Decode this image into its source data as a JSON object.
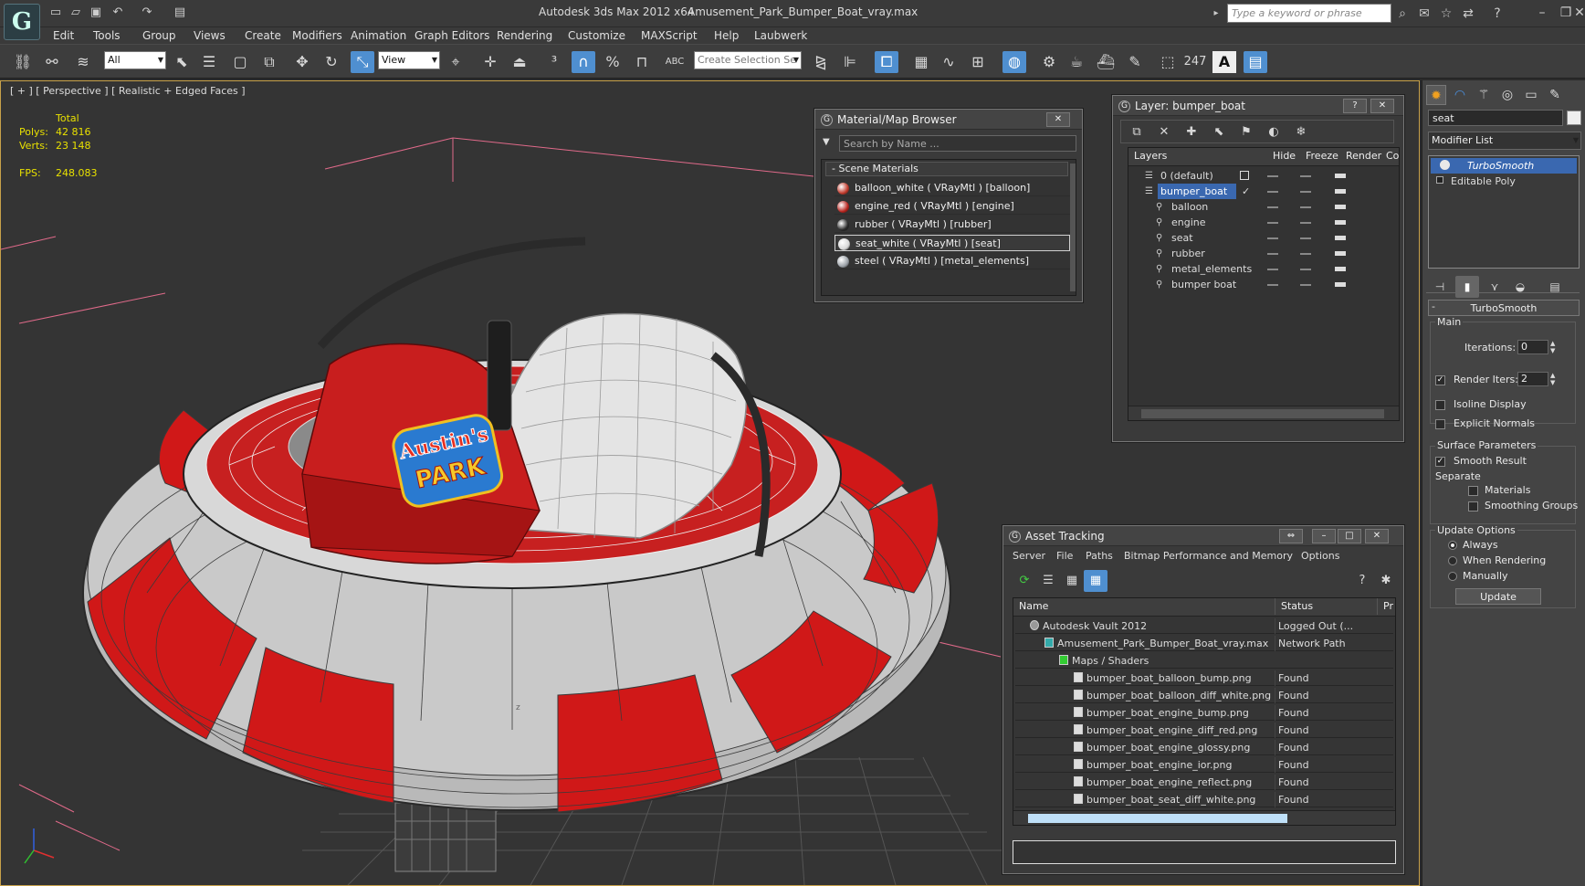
{
  "window": {
    "title": "Autodesk 3ds Max  2012 x64",
    "file": "Amusement_Park_Bumper_Boat_vray.max",
    "search_placeholder": "Type a keyword or phrase"
  },
  "menu": [
    "Edit",
    "Tools",
    "Group",
    "Views",
    "Create",
    "Modifiers",
    "Animation",
    "Graph Editors",
    "Rendering",
    "Customize",
    "MAXScript",
    "Help",
    "Laubwerk"
  ],
  "toolbar": {
    "selection_filter": "All",
    "ref_coord": "View",
    "named_selection": "Create Selection Se",
    "counter": "247",
    "text_tool": "A"
  },
  "viewport": {
    "label_prefix": "[ + ]",
    "label_view": "[ Perspective ]",
    "label_shading": "[ Realistic + Edged Faces ]",
    "stats": {
      "total_label": "Total",
      "polys_label": "Polys:",
      "polys": "42 816",
      "verts_label": "Verts:",
      "verts": "23 148",
      "fps_label": "FPS:",
      "fps": "248.083"
    },
    "logo_text_1": "Austin's",
    "logo_text_2": "PARK",
    "axis_z": "z"
  },
  "material_browser": {
    "title": "Material/Map Browser",
    "search_placeholder": "Search by Name ...",
    "group": "- Scene Materials",
    "materials": [
      {
        "label": "balloon_white  ( VRayMtl )  [balloon]",
        "color": "#c0392b",
        "selected": false
      },
      {
        "label": "engine_red  ( VRayMtl )  [engine]",
        "color": "#b8241e",
        "selected": false
      },
      {
        "label": "rubber  ( VRayMtl )  [rubber]",
        "color": "#2a2a2a",
        "selected": false
      },
      {
        "label": "seat_white  ( VRayMtl )  [seat]",
        "color": "#d8d8d8",
        "selected": true
      },
      {
        "label": "steel  ( VRayMtl )  [metal_elements]",
        "color": "#9aa0a6",
        "selected": false
      }
    ]
  },
  "layer_manager": {
    "title": "Layer: bumper_boat",
    "help": "?",
    "columns": {
      "layers": "Layers",
      "hide": "Hide",
      "freeze": "Freeze",
      "render": "Render",
      "color": "Co"
    },
    "rows": [
      {
        "name": "0 (default)",
        "indent": 0,
        "selected": false
      },
      {
        "name": "bumper_boat",
        "indent": 0,
        "selected": true
      },
      {
        "name": "balloon",
        "indent": 1,
        "selected": false
      },
      {
        "name": "engine",
        "indent": 1,
        "selected": false
      },
      {
        "name": "seat",
        "indent": 1,
        "selected": false
      },
      {
        "name": "rubber",
        "indent": 1,
        "selected": false
      },
      {
        "name": "metal_elements",
        "indent": 1,
        "selected": false
      },
      {
        "name": "bumper boat",
        "indent": 1,
        "selected": false
      }
    ]
  },
  "command_panel": {
    "object_name": "seat",
    "modifier_list": "Modifier List",
    "stack": [
      {
        "name": "TurboSmooth",
        "selected": true
      },
      {
        "name": "Editable Poly",
        "selected": false
      }
    ],
    "rollout_title": "TurboSmooth",
    "main_group": "Main",
    "iterations_label": "Iterations:",
    "iterations": "0",
    "render_iters_label": "Render Iters:",
    "render_iters": "2",
    "render_iters_checked": true,
    "isoline": "Isoline Display",
    "explicit_normals": "Explicit Normals",
    "surface_group": "Surface Parameters",
    "smooth_result": "Smooth Result",
    "separate": "Separate",
    "materials": "Materials",
    "smoothing_groups": "Smoothing Groups",
    "update_group": "Update Options",
    "always": "Always",
    "when_rendering": "When Rendering",
    "manually": "Manually",
    "update_button": "Update"
  },
  "asset_tracking": {
    "title": "Asset Tracking",
    "menu": [
      "Server",
      "File",
      "Paths",
      "Bitmap Performance and Memory",
      "Options"
    ],
    "col_name": "Name",
    "col_status": "Status",
    "col_path": "Pr",
    "rows": [
      {
        "name": "Autodesk Vault 2012",
        "status": "Logged Out (...",
        "indent": 1
      },
      {
        "name": "Amusement_Park_Bumper_Boat_vray.max",
        "status": "Network Path",
        "indent": 2
      },
      {
        "name": "Maps / Shaders",
        "status": "",
        "indent": 3
      },
      {
        "name": "bumper_boat_balloon_bump.png",
        "status": "Found",
        "indent": 4
      },
      {
        "name": "bumper_boat_balloon_diff_white.png",
        "status": "Found",
        "indent": 4
      },
      {
        "name": "bumper_boat_engine_bump.png",
        "status": "Found",
        "indent": 4
      },
      {
        "name": "bumper_boat_engine_diff_red.png",
        "status": "Found",
        "indent": 4
      },
      {
        "name": "bumper_boat_engine_glossy.png",
        "status": "Found",
        "indent": 4
      },
      {
        "name": "bumper_boat_engine_ior.png",
        "status": "Found",
        "indent": 4
      },
      {
        "name": "bumper_boat_engine_reflect.png",
        "status": "Found",
        "indent": 4
      },
      {
        "name": "bumper_boat_seat_diff_white.png",
        "status": "Found",
        "indent": 4
      }
    ]
  },
  "colors": {
    "accent": "#4f8fd0",
    "viewport_border": "#c8a14a",
    "stats": "#e8e000",
    "boat_red": "#d01818",
    "boat_white": "#c9c9c9"
  }
}
